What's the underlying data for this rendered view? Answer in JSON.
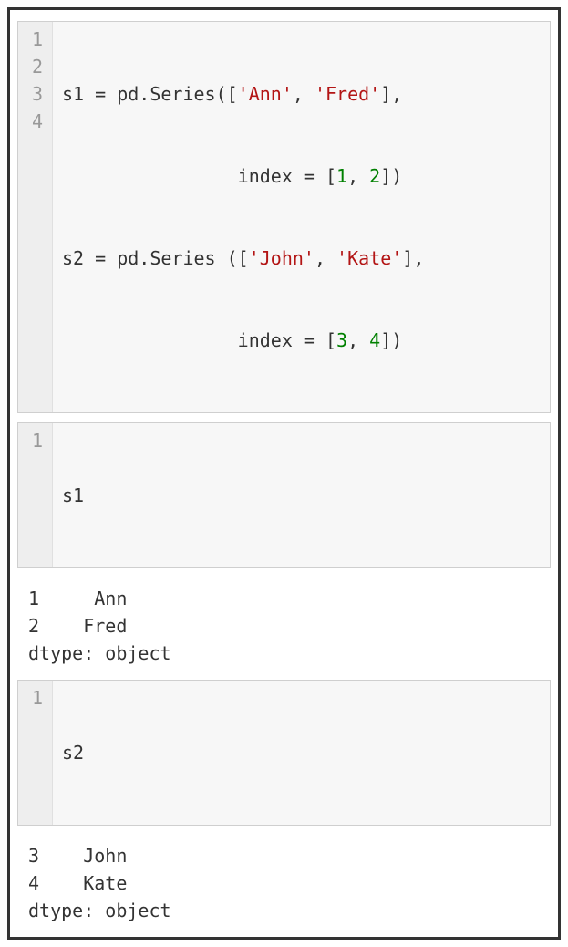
{
  "cell1": {
    "ln1": "1",
    "ln2": "2",
    "ln3": "3",
    "ln4": "4",
    "l1a": "s1 = pd.Series([",
    "l1s1": "'Ann'",
    "l1b": ", ",
    "l1s2": "'Fred'",
    "l1c": "],",
    "l2a": "                index = [",
    "l2n1": "1",
    "l2b": ", ",
    "l2n2": "2",
    "l2c": "])",
    "l3a": "s2 = pd.Series ([",
    "l3s1": "'John'",
    "l3b": ", ",
    "l3s2": "'Kate'",
    "l3c": "],",
    "l4a": "                index = [",
    "l4n1": "3",
    "l4b": ", ",
    "l4n2": "4",
    "l4c": "])"
  },
  "cell2": {
    "ln1": "1",
    "code": "s1",
    "output": "1     Ann\n2    Fred\ndtype: object"
  },
  "cell3": {
    "ln1": "1",
    "code": "s2",
    "output": "3    John\n4    Kate\ndtype: object"
  }
}
